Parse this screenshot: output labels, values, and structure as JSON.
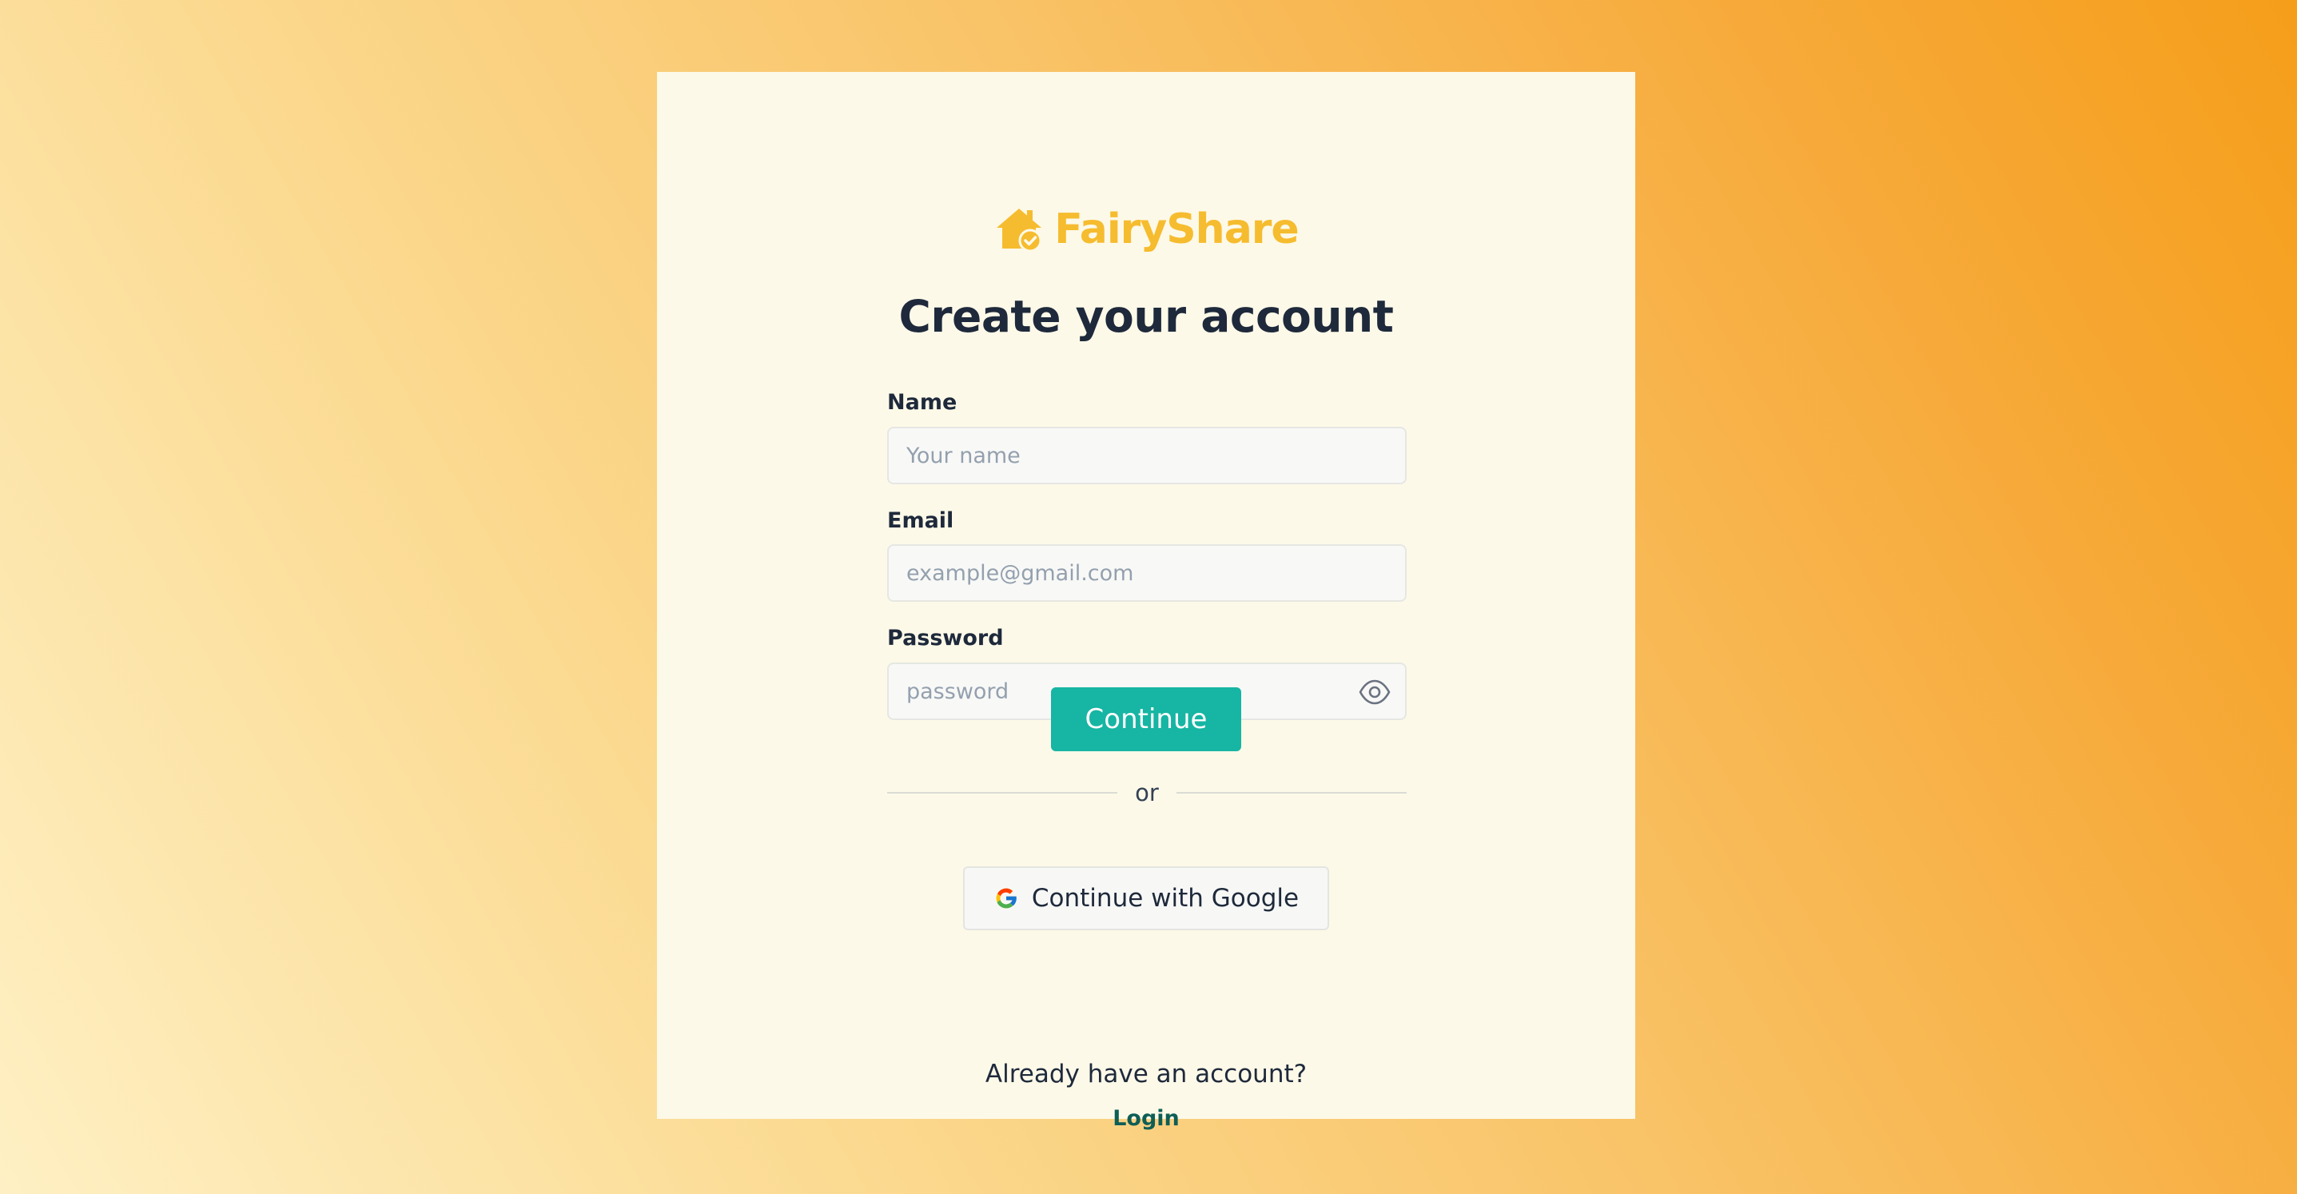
{
  "brand": {
    "name": "FairyShare",
    "color": "#f6bc2f",
    "icon": "house-check-icon"
  },
  "form": {
    "title": "Create your account",
    "name": {
      "label": "Name",
      "placeholder": "Your name",
      "value": ""
    },
    "email": {
      "label": "Email",
      "placeholder": "example@gmail.com",
      "value": ""
    },
    "password": {
      "label": "Password",
      "placeholder": "password",
      "value": "",
      "toggle_icon": "eye-icon"
    },
    "continue_label": "Continue",
    "divider_text": "or",
    "google_label": "Continue with Google",
    "google_icon": "google-icon"
  },
  "footer": {
    "question": "Already have an account?",
    "login_label": "Login"
  },
  "colors": {
    "accent": "#17b5a3",
    "card_bg": "#fdf9e8",
    "heading": "#1e293b",
    "link": "#0f5e56"
  }
}
